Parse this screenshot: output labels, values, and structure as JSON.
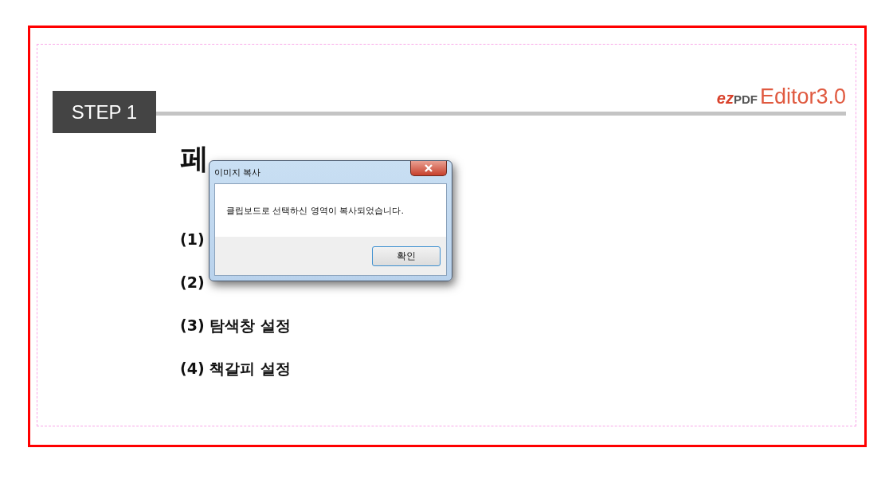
{
  "header": {
    "step": "STEP 1",
    "logo": {
      "brand_small": "ez",
      "brand_pdf": "PDF",
      "product": "Editor3.0"
    }
  },
  "title": "페",
  "items": [
    "(1)",
    "(2)",
    "(3) 탐색창 설정",
    "(4) 책갈피 설정"
  ],
  "dialog": {
    "title": "이미지 복사",
    "message": "클립보드로 선택하신 영역이 복사되었습니다.",
    "button": "확인"
  }
}
